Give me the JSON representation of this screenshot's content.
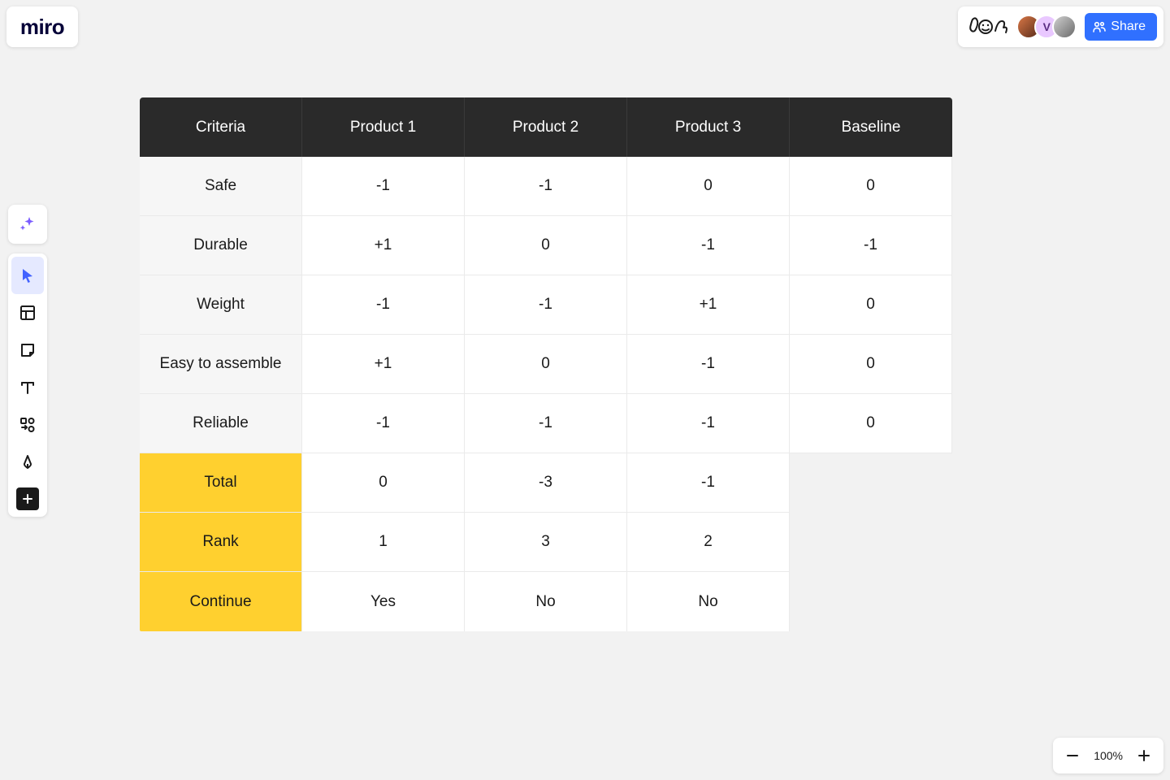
{
  "brand": {
    "logo": "miro"
  },
  "topbar": {
    "share_label": "Share",
    "avatar_letter": "V"
  },
  "zoom": {
    "level": "100%"
  },
  "table": {
    "headers": [
      "Criteria",
      "Product 1",
      "Product 2",
      "Product 3",
      "Baseline"
    ],
    "rows": [
      {
        "label": "Safe",
        "values": [
          "-1",
          "-1",
          "0",
          "0"
        ]
      },
      {
        "label": "Durable",
        "values": [
          "+1",
          "0",
          "-1",
          "-1"
        ]
      },
      {
        "label": "Weight",
        "values": [
          "-1",
          "-1",
          "+1",
          "0"
        ]
      },
      {
        "label": "Easy to assemble",
        "values": [
          "+1",
          "0",
          "-1",
          "0"
        ]
      },
      {
        "label": "Reliable",
        "values": [
          "-1",
          "-1",
          "-1",
          "0"
        ]
      }
    ],
    "summary": [
      {
        "label": "Total",
        "values": [
          "0",
          "-3",
          "-1"
        ]
      },
      {
        "label": "Rank",
        "values": [
          "1",
          "3",
          "2"
        ]
      },
      {
        "label": "Continue",
        "values": [
          "Yes",
          "No",
          "No"
        ]
      }
    ]
  }
}
